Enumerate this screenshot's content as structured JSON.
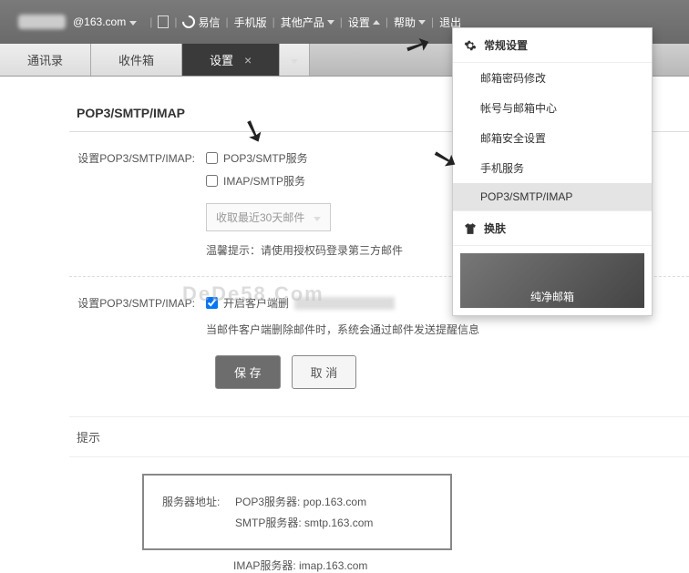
{
  "topbar": {
    "email": "@163.com",
    "yixin": "易信",
    "mobile": "手机版",
    "other": "其他产品",
    "settings": "设置",
    "help": "帮助",
    "logout": "退出"
  },
  "tabs": {
    "contacts": "通讯录",
    "inbox": "收件箱",
    "settings": "设置"
  },
  "panel": {
    "title": "POP3/SMTP/IMAP",
    "label1": "设置POP3/SMTP/IMAP:",
    "check_pop": "POP3/SMTP服务",
    "check_imap": "IMAP/SMTP服务",
    "select_days": "收取最近30天邮件",
    "tip1": "温馨提示：请使用授权码登录第三方邮件",
    "label2": "设置POP3/SMTP/IMAP:",
    "check_client": "开启客户端删",
    "tip2": "当邮件客户端删除邮件时，系统会通过邮件发送提醒信息",
    "save": "保 存",
    "cancel": "取 消"
  },
  "tips": {
    "head": "提示",
    "server_label": "服务器地址:",
    "pop": "POP3服务器: pop.163.com",
    "smtp": "SMTP服务器: smtp.163.com",
    "imap": "IMAP服务器: imap.163.com"
  },
  "dropdown": {
    "head1": "常规设置",
    "items": [
      "邮箱密码修改",
      "帐号与邮箱中心",
      "邮箱安全设置",
      "手机服务",
      "POP3/SMTP/IMAP"
    ],
    "head2": "换肤",
    "banner": "纯净邮箱"
  },
  "watermark": "DeDe58.Com"
}
